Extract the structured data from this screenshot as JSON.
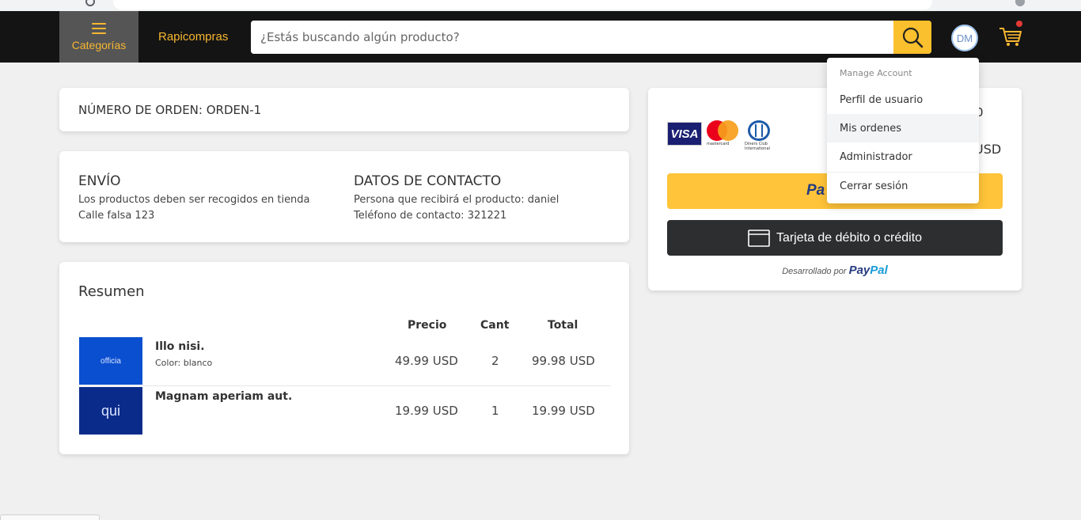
{
  "header": {
    "categories_label": "Categorías",
    "brand": "Rapicompras",
    "search_placeholder": "¿Estás buscando algún producto?",
    "avatar_initials": "DM"
  },
  "order": {
    "label": "NÚMERO DE ORDEN: ORDEN-1"
  },
  "shipping": {
    "title": "ENVÍO",
    "line1": "Los productos deben ser recogidos en tienda",
    "line2": "Calle falsa 123"
  },
  "contact": {
    "title": "DATOS DE CONTACTO",
    "line1": "Persona que recibirá el producto: daniel",
    "line2": "Teléfono de contacto: 321221"
  },
  "summary": {
    "title": "Resumen",
    "columns": [
      "Precio",
      "Cant",
      "Total"
    ],
    "items": [
      {
        "thumb_text": "officia",
        "thumb_color": "#0a4fd0",
        "name": "Illo nisi.",
        "variant": "Color: blanco",
        "price": "49.99 USD",
        "qty": "2",
        "total": "99.98 USD"
      },
      {
        "thumb_text": "qui",
        "thumb_color": "#0b2b8a",
        "name": "Magnam aperiam aut.",
        "variant": "",
        "price": "19.99 USD",
        "qty": "1",
        "total": "19.99 USD"
      }
    ]
  },
  "payment": {
    "partial_top": "0",
    "partial_total": "USD",
    "logos": [
      "VISA",
      "mastercard",
      "Diners Club International"
    ],
    "paypal_button_text": "Pa",
    "card_button_label": "Tarjeta de débito o crédito",
    "powered_by": "Desarrollado por",
    "paypal_word_1": "Pay",
    "paypal_word_2": "Pal"
  },
  "account_menu": {
    "heading": "Manage Account",
    "items": [
      "Perfil de usuario",
      "Mis ordenes",
      "Administrador",
      "Cerrar sesión"
    ]
  },
  "colors": {
    "accent": "#f7b731",
    "header_bg": "#141414",
    "search_button": "#fbc02d",
    "paypal_yellow": "#ffc439",
    "card_button": "#2c2e2f"
  }
}
